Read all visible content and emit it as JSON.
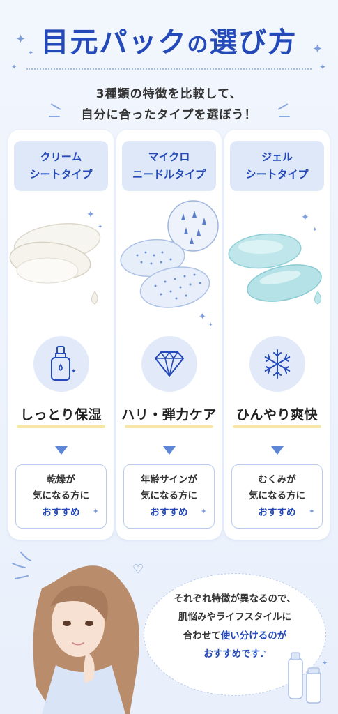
{
  "title": {
    "main": "目元パック",
    "no": "の",
    "rest": "選び方"
  },
  "subtitle": {
    "line1": "3種類の特徴を比較して、",
    "line2": "自分に合ったタイプを選ぼう！"
  },
  "columns": [
    {
      "header_line1": "クリーム",
      "header_line2": "シートタイプ",
      "feature": "しっとり保湿",
      "rec_line1": "乾燥が",
      "rec_line2": "気になる方に",
      "rec_line3": "おすすめ",
      "icon": "serum-bottle-icon"
    },
    {
      "header_line1": "マイクロ",
      "header_line2": "ニードルタイプ",
      "feature": "ハリ・弾力ケア",
      "rec_line1": "年齢サインが",
      "rec_line2": "気になる方に",
      "rec_line3": "おすすめ",
      "icon": "diamond-icon"
    },
    {
      "header_line1": "ジェル",
      "header_line2": "シートタイプ",
      "feature": "ひんやり爽快",
      "rec_line1": "むくみが",
      "rec_line2": "気になる方に",
      "rec_line3": "おすすめ",
      "icon": "snowflake-icon"
    }
  ],
  "bubble": {
    "line1": "それぞれ特徴が異なるので、",
    "line2": "肌悩みやライフスタイルに",
    "line3_plain": "合わせて",
    "line3_hl": "使い分けるのが",
    "line4": "おすすめです♪"
  },
  "colors": {
    "accent": "#2449b8",
    "panel": "#dfe8f9",
    "highlight": "#f7e6a6"
  }
}
